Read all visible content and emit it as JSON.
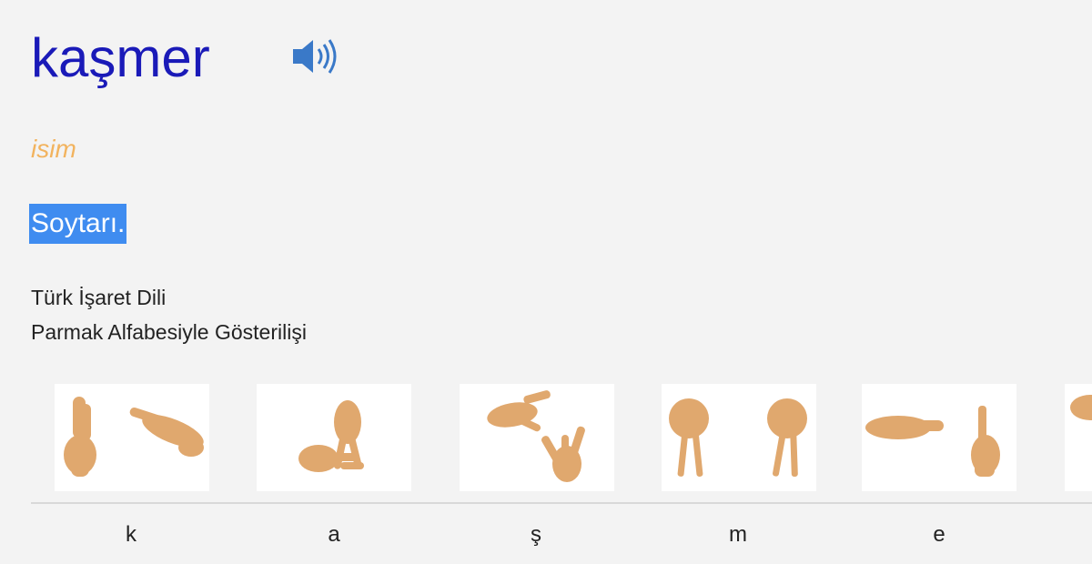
{
  "entry": {
    "word": "kaşmer",
    "part_of_speech": "isim",
    "definition": "Soytarı."
  },
  "sign_language": {
    "title_line1": "Türk İşaret Dili",
    "title_line2": "Parmak Alfabesiyle Gösterilişi"
  },
  "letters": [
    "k",
    "a",
    "ş",
    "m",
    "e"
  ],
  "colors": {
    "headword": "#1a1ab8",
    "part_of_speech": "#f2b35e",
    "selection": "#3f8cf0",
    "hand": "#e0a86e",
    "speaker": "#3a79c8"
  },
  "icons": {
    "speaker": "speaker-icon"
  }
}
